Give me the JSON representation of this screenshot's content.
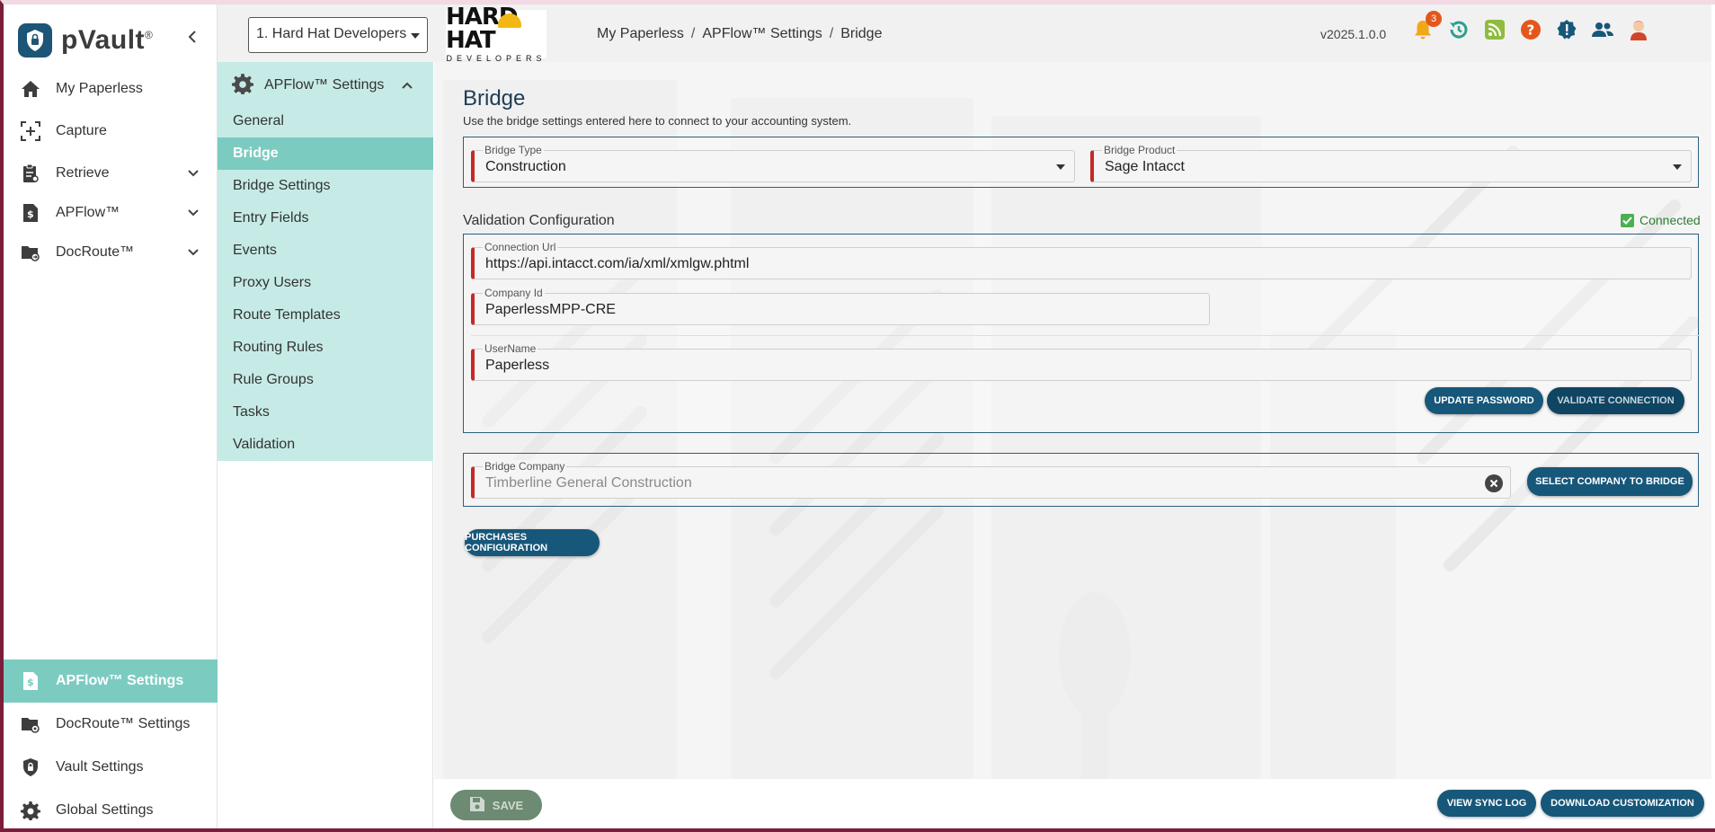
{
  "app": {
    "name": "pVault",
    "registered_mark": "®"
  },
  "sidebar": {
    "items": [
      {
        "label": "My Paperless",
        "icon": "home-icon"
      },
      {
        "label": "Capture",
        "icon": "capture-icon"
      },
      {
        "label": "Retrieve",
        "icon": "retrieve-icon"
      },
      {
        "label": "APFlow™",
        "icon": "apflow-icon"
      },
      {
        "label": "DocRoute™",
        "icon": "docroute-icon"
      }
    ],
    "bottom_items": [
      {
        "label": "APFlow™ Settings",
        "icon": "apflow-settings-icon",
        "active": true
      },
      {
        "label": "DocRoute™ Settings",
        "icon": "docroute-settings-icon"
      },
      {
        "label": "Vault Settings",
        "icon": "vault-settings-icon"
      },
      {
        "label": "Global Settings",
        "icon": "gear-icon"
      }
    ]
  },
  "topbar": {
    "company_selector": "1. Hard Hat Developers",
    "client_logo_text": "HARD HAT",
    "client_logo_subtext": "DEVELOPERS",
    "breadcrumb": [
      "My Paperless",
      "APFlow™ Settings",
      "Bridge"
    ],
    "breadcrumb_separator": "/",
    "version": "v2025.1.0.0",
    "notifications_count": "3"
  },
  "subnav": {
    "header": "APFlow™ Settings",
    "items": [
      "General",
      "Bridge",
      "Bridge Settings",
      "Entry Fields",
      "Events",
      "Proxy Users",
      "Route Templates",
      "Routing Rules",
      "Rule Groups",
      "Tasks",
      "Validation"
    ],
    "active_index": 1
  },
  "main": {
    "title": "Bridge",
    "description": "Use the bridge settings entered here to connect to your accounting system.",
    "bridge_type": {
      "label": "Bridge Type",
      "value": "Construction"
    },
    "bridge_product": {
      "label": "Bridge Product",
      "value": "Sage Intacct"
    },
    "validation": {
      "title": "Validation Configuration",
      "status": "Connected",
      "connection_url": {
        "label": "Connection Url",
        "value": "https://api.intacct.com/ia/xml/xmlgw.phtml"
      },
      "company_id": {
        "label": "Company Id",
        "value": "PaperlessMPP-CRE"
      },
      "username": {
        "label": "UserName",
        "value": "Paperless"
      },
      "update_password_label": "UPDATE PASSWORD",
      "validate_connection_label": "VALIDATE CONNECTION"
    },
    "bridge_company": {
      "label": "Bridge Company",
      "value": "Timberline General Construction"
    },
    "select_company_label": "SELECT COMPANY TO BRIDGE",
    "purchases_config_label": "PURCHASES CONFIGURATION"
  },
  "footer": {
    "save_label": "SAVE",
    "view_sync_log_label": "VIEW SYNC LOG",
    "download_customization_label": "DOWNLOAD CUSTOMIZATION"
  },
  "colors": {
    "primary": "#17577a",
    "teal_active": "#7ccbc1",
    "teal_light": "#c6ebe6",
    "required_marker": "#c62828",
    "connected": "#2e7d32",
    "badge": "#e4571b"
  }
}
